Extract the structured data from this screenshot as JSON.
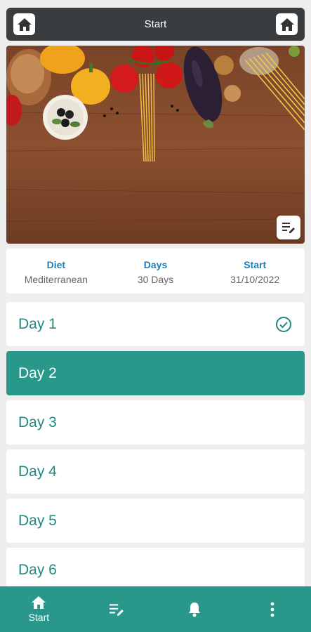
{
  "header": {
    "title": "Start",
    "left_icon": "home-icon",
    "right_icon": "home-icon"
  },
  "hero": {
    "image": "vegetables-on-wooden-table",
    "edit_icon": "edit-list-icon"
  },
  "info": [
    {
      "label": "Diet",
      "value": "Mediterranean"
    },
    {
      "label": "Days",
      "value": "30 Days"
    },
    {
      "label": "Start",
      "value": "31/10/2022"
    }
  ],
  "days": [
    {
      "label": "Day 1",
      "completed": true
    },
    {
      "label": "Day 2",
      "selected": true
    },
    {
      "label": "Day 3"
    },
    {
      "label": "Day 4"
    },
    {
      "label": "Day 5"
    },
    {
      "label": "Day 6"
    }
  ],
  "bottom_nav": {
    "items": [
      {
        "label": "Start",
        "icon": "home-icon"
      },
      {
        "icon": "edit-list-icon"
      },
      {
        "icon": "bell-icon"
      },
      {
        "icon": "more-vert-icon"
      }
    ]
  },
  "colors": {
    "accent": "#2a978b",
    "header_bg": "#3a3d3f",
    "info_label": "#1e7fb8",
    "day_text": "#1f8a80"
  }
}
